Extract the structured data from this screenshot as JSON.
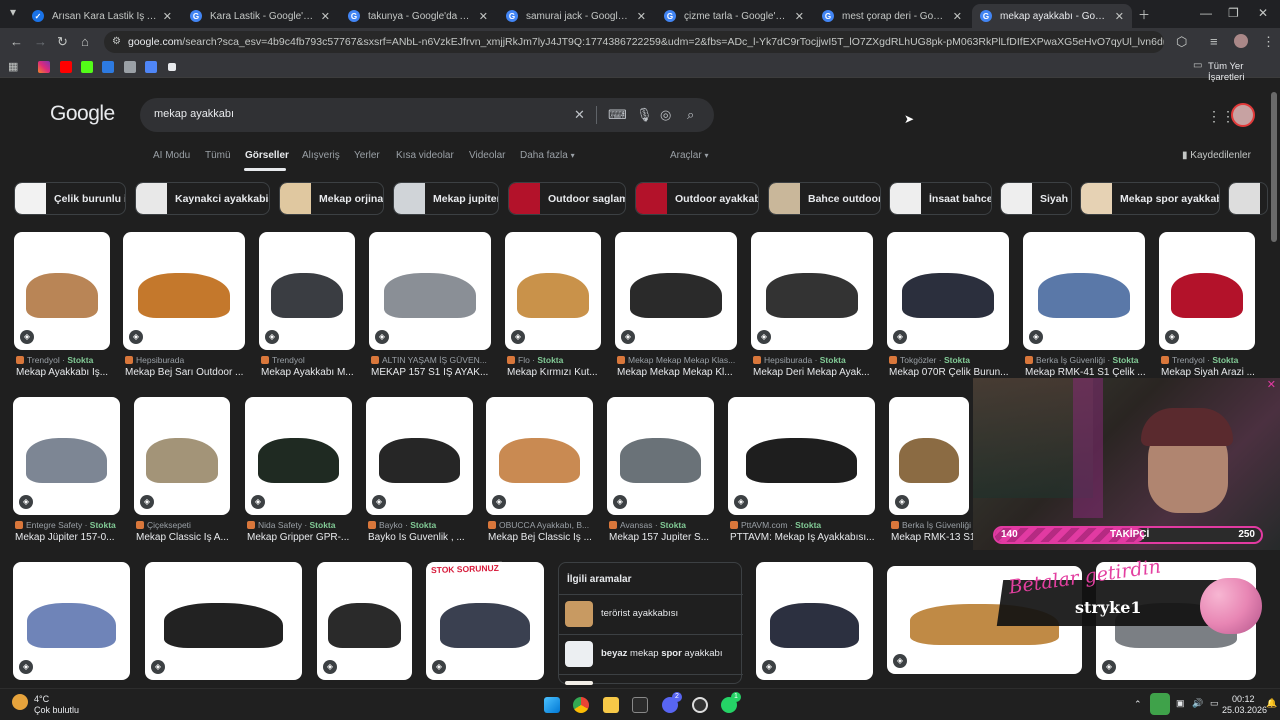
{
  "tabs": [
    {
      "title": "Arısan Kara Lastik İş Ayakkabısı",
      "color": "#1a73e8",
      "icon": "check-icon"
    },
    {
      "title": "Kara Lastik - Google'da Ara",
      "color": "#4285f4",
      "icon": "google-icon"
    },
    {
      "title": "takunya - Google'da Ara",
      "color": "#4285f4",
      "icon": "google-icon"
    },
    {
      "title": "samurai jack - Google'da Ara",
      "color": "#4285f4",
      "icon": "google-icon"
    },
    {
      "title": "çizme tarla - Google'da Ara",
      "color": "#4285f4",
      "icon": "google-icon"
    },
    {
      "title": "mest çorap deri - Google'da Ara",
      "color": "#4285f4",
      "icon": "google-icon"
    },
    {
      "title": "mekap ayakkabı - Google'da Ara",
      "color": "#4285f4",
      "icon": "google-icon",
      "active": true
    }
  ],
  "address": {
    "host": "google.com",
    "path": "/search?sca_esv=4b9c4fb793c57767&sxsrf=ANbL-n6VzkEJfrvn_xmjjRkJm7lyJ4JT9Q:1774386722259&udm=2&fbs=ADc_l-Yk7dC9rTocjjwI5T_lO7ZXgdRLhUG8pk-pM063RkPlLfDIfEXPwaXG5eHvO7qyUl_lvn6dnxb7YeRdVLaKqpxDFdTT3..."
  },
  "bookmarks": {
    "other_label": "Tüm Yer İşaretleri"
  },
  "google": {
    "logo": "Google",
    "query": "mekap ayakkabı",
    "saved": "Kaydedilenler",
    "tools": "Araçlar"
  },
  "nav_tabs": [
    "AI Modu",
    "Tümü",
    "Görseller",
    "Alışveriş",
    "Yerler",
    "Kısa videolar",
    "Videolar",
    "Daha fazla"
  ],
  "chips": [
    "Çelik burunlu iş",
    "Kaynakci ayakkabisi",
    "Mekap orjinal",
    "Mekap jupiter",
    "Outdoor saglam",
    "Outdoor ayakkabı",
    "Bahce outdoor",
    "İnsaat bahce",
    "Siyah",
    "Mekap spor ayakkabı"
  ],
  "row1": [
    {
      "source": "Trendyol",
      "stock": "Stokta",
      "caption": "Mekap Ayakkabı İş...",
      "color": "#b98556"
    },
    {
      "source": "Hepsiburada",
      "stock": "",
      "caption": "Mekap Bej Sarı Outdoor ...",
      "color": "#c4782c"
    },
    {
      "source": "Trendyol",
      "stock": "",
      "caption": "Mekap Ayakkabı M...",
      "color": "#3a3d42"
    },
    {
      "source": "ALTIN YAŞAM İŞ GÜVEN...",
      "stock": "",
      "caption": "MEKAP 157 S1 İŞ AYAK...",
      "color": "#8a8f96"
    },
    {
      "source": "Flo",
      "stock": "Stokta",
      "caption": "Mekap Kırmızı Kut...",
      "color": "#c9924a"
    },
    {
      "source": "Mekap Mekap Mekap Klas...",
      "stock": "",
      "caption": "Mekap Mekap Mekap Kl...",
      "color": "#2a2a2a"
    },
    {
      "source": "Hepsiburada",
      "stock": "Stokta",
      "caption": "Mekap Deri Mekap Ayak...",
      "color": "#333"
    },
    {
      "source": "Tokgözler",
      "stock": "Stokta",
      "caption": "Mekap 070R Çelik Burun...",
      "color": "#2b2f3d"
    },
    {
      "source": "Berka İş Güvenliği",
      "stock": "Stokta",
      "caption": "Mekap RMK-41 S1 Çelik ...",
      "color": "#5a78a8"
    },
    {
      "source": "Trendyol",
      "stock": "Stokta",
      "caption": "Mekap Siyah Arazi ...",
      "color": "#b3122a"
    }
  ],
  "row2": [
    {
      "source": "Entegre Safety",
      "stock": "Stokta",
      "caption": "Mekap Jüpiter 157-0...",
      "color": "#7d8694"
    },
    {
      "source": "Çiçeksepeti",
      "stock": "",
      "caption": "Mekap Classic İş A...",
      "color": "#a39478"
    },
    {
      "source": "Nida Safety",
      "stock": "Stokta",
      "caption": "Mekap Gripper GPR-...",
      "color": "#1f2a22"
    },
    {
      "source": "Bayko",
      "stock": "Stokta",
      "caption": "Bayko Is Guvenlik , ...",
      "color": "#262626"
    },
    {
      "source": "OBUCCA Ayakkabı, B...",
      "stock": "",
      "caption": "Mekap Bej Classic İş ...",
      "color": "#c98a52"
    },
    {
      "source": "Avansas",
      "stock": "Stokta",
      "caption": "Mekap 157 Jupiter S...",
      "color": "#6a7278"
    },
    {
      "source": "PttAVM.com",
      "stock": "Stokta",
      "caption": "PTTAVM: Mekap İş Ayakkabısı...",
      "color": "#1e1e1e"
    },
    {
      "source": "Berka İş Güvenliği",
      "stock": "",
      "caption": "Mekap RMK-13 S1",
      "color": "#8b6b43"
    }
  ],
  "row3": [
    {
      "color": "#6f84b8"
    },
    {
      "color": "#222"
    },
    {
      "color": "#2a2a2a"
    },
    {
      "color": "#3a4050"
    },
    {
      "color": "#2c3040"
    },
    {
      "color": "#c08a45"
    },
    {
      "color": "#7b7f84"
    }
  ],
  "related": {
    "title": "İlgili aramalar",
    "items": [
      {
        "pre": "terörist ayakkabısı",
        "b1": "",
        "mid": "",
        "b2": "",
        "post": ""
      },
      {
        "pre": "",
        "b1": "beyaz",
        "mid": " mekap ",
        "b2": "spor",
        "post": " ayakkabı"
      }
    ]
  },
  "stream": {
    "followers_current": "140",
    "followers_label": "TAKİPÇİ",
    "followers_goal": "250",
    "followers_progress": 0.56,
    "banner_text": "Betalar getirdin",
    "username": "stryke1",
    "stock_sticker": "STOK SORUNUZ"
  },
  "taskbar": {
    "weather_temp": "4°C",
    "weather_desc": "Çok bulutlu",
    "time": "00:12",
    "date": "25.03.2026",
    "notif_discord": "2",
    "notif_whatsapp": "1"
  }
}
